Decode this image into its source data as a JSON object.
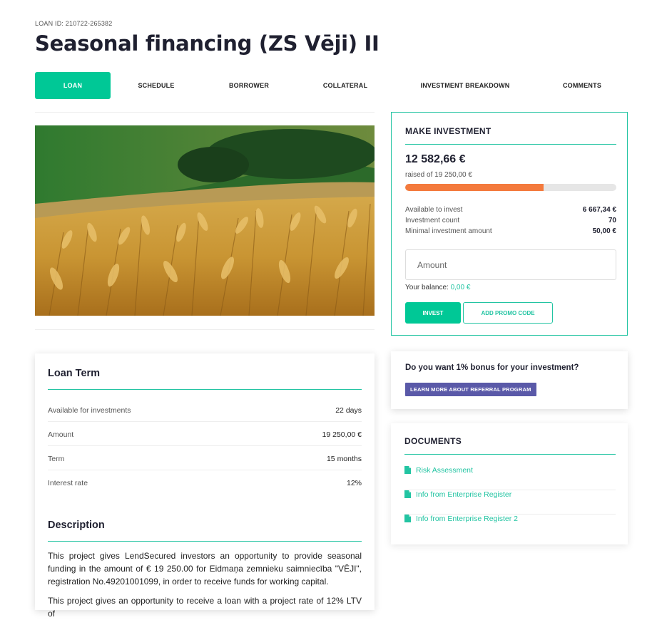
{
  "header": {
    "loan_id": "LOAN ID: 210722-265382",
    "title": "Seasonal financing (ZS Vēji) II"
  },
  "tabs": [
    {
      "label": "LOAN",
      "active": true
    },
    {
      "label": "SCHEDULE",
      "active": false
    },
    {
      "label": "BORROWER",
      "active": false
    },
    {
      "label": "COLLATERAL",
      "active": false
    },
    {
      "label": "INVESTMENT BREAKDOWN",
      "active": false
    },
    {
      "label": "COMMENTS",
      "active": false
    }
  ],
  "investment": {
    "title": "MAKE INVESTMENT",
    "raised_amount": "12 582,66 €",
    "raised_of": "raised of 19 250,00 €",
    "progress_fraction": 0.654,
    "stats": [
      {
        "label": "Available to invest",
        "value": "6 667,34 €"
      },
      {
        "label": "Investment count",
        "value": "70"
      },
      {
        "label": "Minimal investment amount",
        "value": "50,00 €"
      }
    ],
    "amount_placeholder": "Amount",
    "balance_label": "Your balance:",
    "balance_value": "0,00 €",
    "invest_button": "INVEST",
    "promo_button": "ADD PROMO CODE"
  },
  "bonus": {
    "title": "Do you want 1% bonus for your investment?",
    "button": "LEARN MORE ABOUT REFERRAL PROGRAM"
  },
  "documents": {
    "title": "DOCUMENTS",
    "items": [
      {
        "label": "Risk Assessment"
      },
      {
        "label": "Info from Enterprise Register"
      },
      {
        "label": "Info from Enterprise Register 2"
      }
    ]
  },
  "loan_term": {
    "title": "Loan Term",
    "rows": [
      {
        "label": "Available for investments",
        "value": "22 days"
      },
      {
        "label": "Amount",
        "value": "19 250,00 €"
      },
      {
        "label": "Term",
        "value": "15 months"
      },
      {
        "label": "Interest rate",
        "value": "12%"
      }
    ]
  },
  "description": {
    "title": "Description",
    "paragraphs": [
      "This project gives LendSecured investors an opportunity to provide seasonal funding in the amount of € 19 250.00 for Eidmaņa zemnieku saimniecība \"VĒJI\", registration No.49201001099, in order to receive funds for working capital.",
      "This project gives an opportunity to receive a loan with a project rate of 12% LTV of"
    ]
  },
  "colors": {
    "accent": "#00c896",
    "progress": "#f47a3d",
    "referral": "#5a59a8",
    "title": "#1f2030"
  }
}
